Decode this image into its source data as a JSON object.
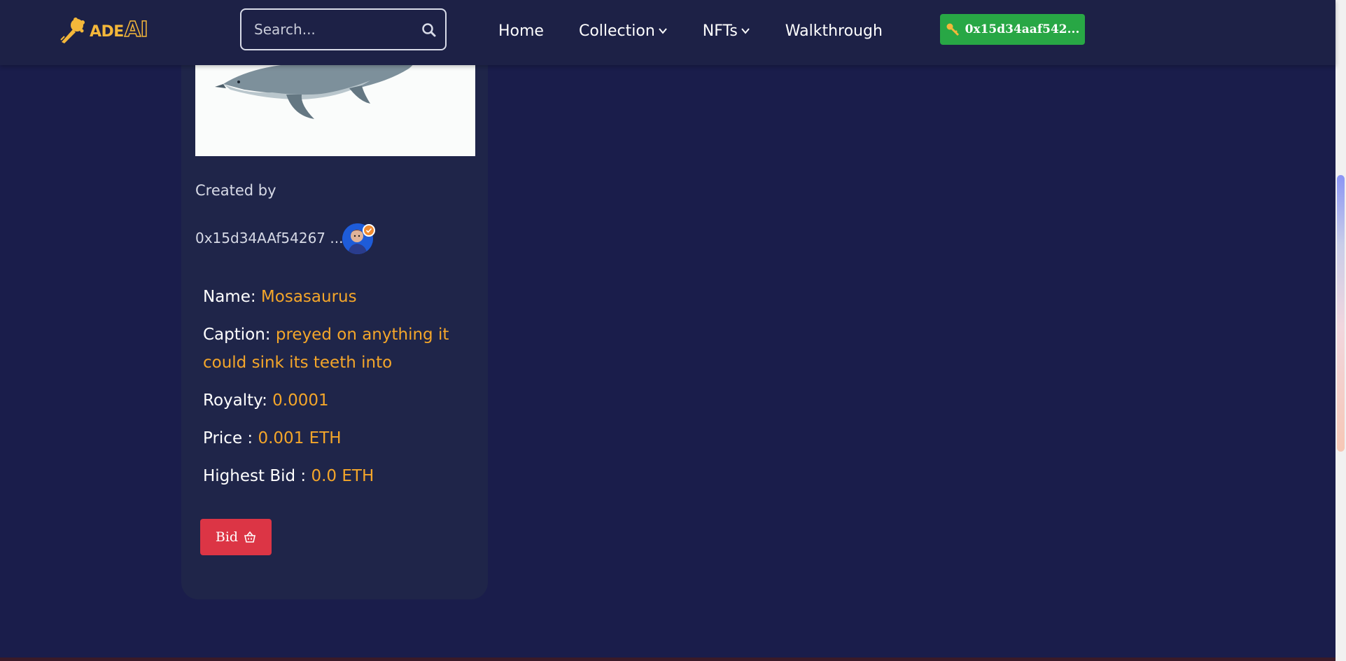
{
  "header": {
    "logo_text": "ADE",
    "logo_text_ai": "AI",
    "search": {
      "placeholder": "Search..."
    },
    "nav": [
      {
        "label": "Home"
      },
      {
        "label": "Collection"
      },
      {
        "label": "NFTs"
      },
      {
        "label": "Walkthrough"
      }
    ],
    "wallet": {
      "label": "0x15d34aaf542..."
    }
  },
  "nft": {
    "created_by_label": "Created by",
    "creator_address": "0x15d34AAf54267 ...",
    "fields": {
      "name_label": "Name:",
      "name_value": "Mosasaurus",
      "caption_label": "Caption:",
      "caption_value": "preyed on anything it could sink its teeth into",
      "royalty_label": "Royalty:",
      "royalty_value": "0.0001",
      "price_label": "Price :",
      "price_value": "0.001 ETH",
      "bid_label": "Highest Bid :",
      "bid_value": "0.0 ETH"
    },
    "bid_button": "Bid"
  },
  "colors": {
    "background": "#1a1d4b",
    "card": "#1f2549",
    "accent_value": "#f4a62a",
    "wallet_button": "#28a745",
    "bid_button": "#dc3545"
  },
  "icons": [
    "logo-torch-icon",
    "search-icon",
    "chevron-down-icon",
    "key-icon",
    "verified-check-icon",
    "basket-icon"
  ]
}
